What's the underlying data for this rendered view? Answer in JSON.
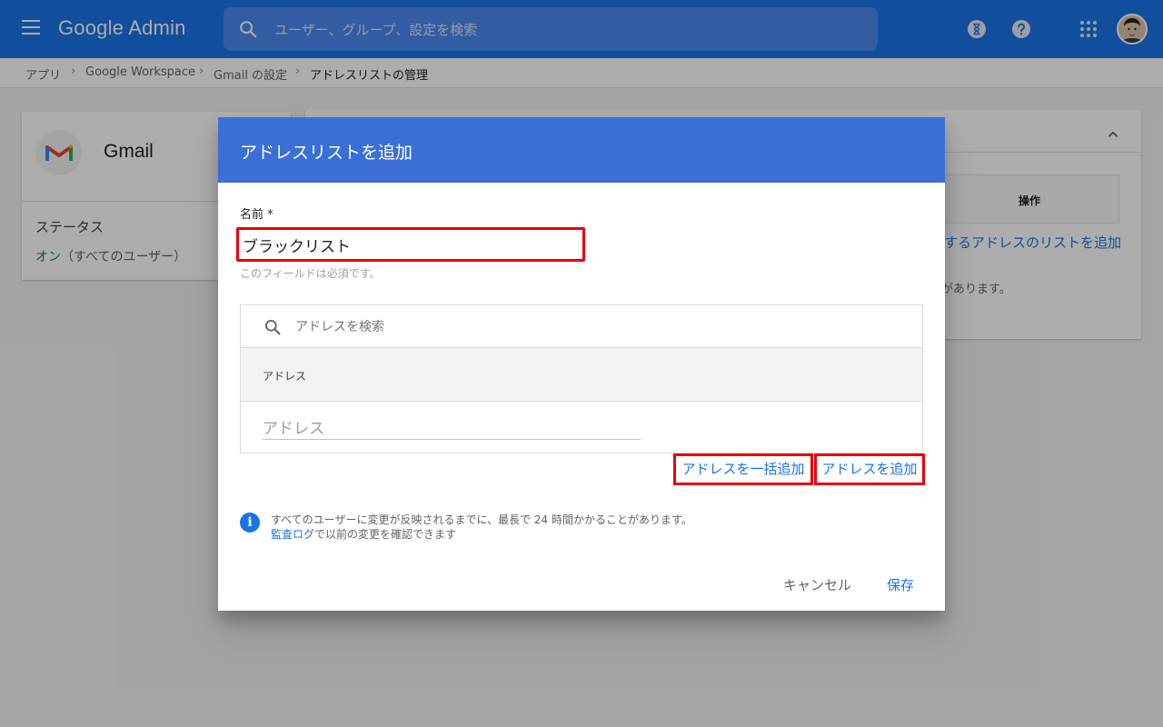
{
  "header": {
    "brand": "Google Admin",
    "search_placeholder": "ユーザー、グループ、設定を検索",
    "icons": [
      "menu-icon",
      "search-icon",
      "hourglass-icon",
      "help-icon",
      "apps-grid-icon",
      "avatar"
    ]
  },
  "breadcrumb": {
    "items": [
      "アプリ",
      "Google Workspace",
      "Gmail の設定",
      "アドレスリストの管理"
    ],
    "separator": "›"
  },
  "left_card": {
    "app_name": "Gmail",
    "status_label": "ステータス",
    "status_on": "オン",
    "status_scope": "（すべてのユーザー）"
  },
  "right_card": {
    "ops_header": "操作",
    "add_list_link": "するアドレスのリストを追加",
    "note_fragment": "があります。"
  },
  "dialog": {
    "title": "アドレスリストを追加",
    "name_label": "名前 *",
    "name_value": "ブラックリスト",
    "required_hint": "このフィールドは必須です。",
    "address_search_placeholder": "アドレスを検索",
    "address_column_header": "アドレス",
    "address_input_placeholder": "アドレス",
    "bulk_add_button": "アドレスを一括追加",
    "add_button": "アドレスを追加",
    "info_line1": "すべてのユーザーに変更が反映されるまでに、最長で 24 時間かかることがあります。",
    "info_audit_link": "監査ログ",
    "info_line2_rest": "で以前の変更を確認できます",
    "cancel_button": "キャンセル",
    "save_button": "保存"
  },
  "colors": {
    "topbar": "#1a73e8",
    "dialog_header": "#3b6fd8",
    "link": "#1a73e8",
    "highlight_border": "#e8000b",
    "status_on": "#188038"
  }
}
